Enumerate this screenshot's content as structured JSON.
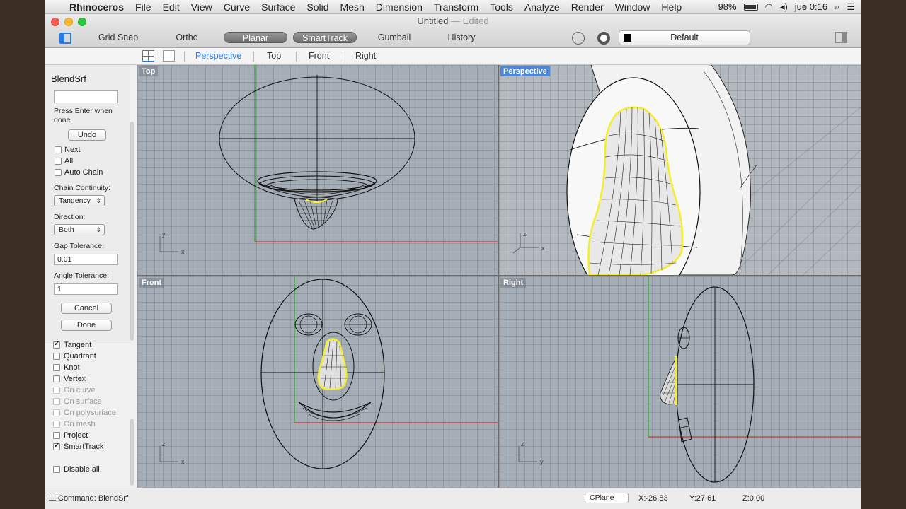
{
  "menubar": {
    "app": "Rhinoceros",
    "items": [
      "File",
      "Edit",
      "View",
      "Curve",
      "Surface",
      "Solid",
      "Mesh",
      "Dimension",
      "Transform",
      "Tools",
      "Analyze",
      "Render",
      "Window",
      "Help"
    ],
    "battery": "98%",
    "clock": "jue 0:16"
  },
  "window": {
    "title": "Untitled",
    "status": "— Edited"
  },
  "toolbar": {
    "grid_snap": "Grid Snap",
    "ortho": "Ortho",
    "planar": "Planar",
    "smarttrack": "SmartTrack",
    "gumball": "Gumball",
    "history": "History",
    "layer": "Default"
  },
  "tabs": [
    "Perspective",
    "Top",
    "Front",
    "Right"
  ],
  "command_panel": {
    "title": "BlendSrf",
    "hint": "Press Enter when done",
    "undo": "Undo",
    "options": [
      {
        "label": "Next",
        "checked": false
      },
      {
        "label": "All",
        "checked": false
      },
      {
        "label": "Auto Chain",
        "checked": false
      }
    ],
    "chain_continuity_label": "Chain Continuity:",
    "chain_continuity_value": "Tangency",
    "direction_label": "Direction:",
    "direction_value": "Both",
    "gap_tolerance_label": "Gap Tolerance:",
    "gap_tolerance_value": "0.01",
    "angle_tolerance_label": "Angle Tolerance:",
    "angle_tolerance_value": "1",
    "cancel": "Cancel",
    "done": "Done"
  },
  "osnaps": [
    {
      "label": "Tangent",
      "checked": true,
      "enabled": true
    },
    {
      "label": "Quadrant",
      "checked": false,
      "enabled": true
    },
    {
      "label": "Knot",
      "checked": false,
      "enabled": true
    },
    {
      "label": "Vertex",
      "checked": false,
      "enabled": true
    },
    {
      "label": "On curve",
      "checked": false,
      "enabled": false
    },
    {
      "label": "On surface",
      "checked": false,
      "enabled": false
    },
    {
      "label": "On polysurface",
      "checked": false,
      "enabled": false
    },
    {
      "label": "On mesh",
      "checked": false,
      "enabled": false
    },
    {
      "label": "Project",
      "checked": false,
      "enabled": true
    },
    {
      "label": "SmartTrack",
      "checked": true,
      "enabled": true
    },
    {
      "label": "Disable all",
      "checked": false,
      "enabled": true
    }
  ],
  "viewports": {
    "top": "Top",
    "perspective": "Perspective",
    "front": "Front",
    "right": "Right"
  },
  "statusbar": {
    "command_label": "Command:",
    "command_value": "BlendSrf",
    "cplane": "CPlane",
    "x": "X:-26.83",
    "y": "Y:27.61",
    "z": "Z:0.00"
  },
  "colors": {
    "accent": "#2a7be4",
    "selection_yellow": "#f2ee2e",
    "viewport_bg": "#a5adb6"
  }
}
